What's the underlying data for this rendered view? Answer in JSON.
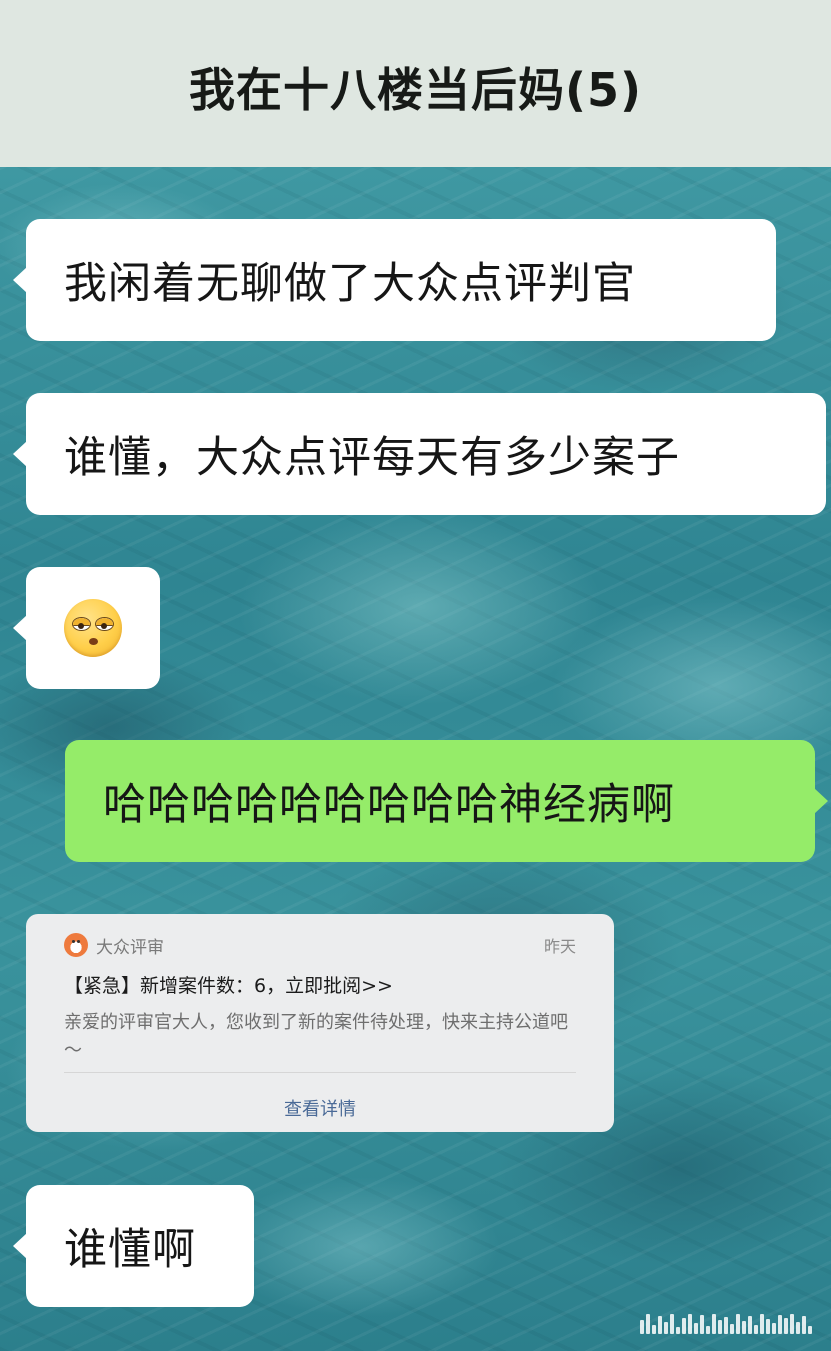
{
  "header": {
    "title": "我在十八楼当后妈(5)"
  },
  "messages": [
    {
      "side": "left",
      "text": "我闲着无聊做了大众点评判官"
    },
    {
      "side": "left",
      "text": "谁懂，大众点评每天有多少案子"
    },
    {
      "side": "left",
      "emoji": "flushed-face-emoji"
    },
    {
      "side": "right",
      "text": "哈哈哈哈哈哈哈哈哈神经病啊"
    },
    {
      "side": "left",
      "type": "notification-card"
    },
    {
      "side": "left",
      "text": "谁懂啊"
    }
  ],
  "card": {
    "app_name": "大众评审",
    "time": "昨天",
    "title": "【紧急】新增案件数：6，立即批阅>>",
    "body": "亲爱的评审官大人，您收到了新的案件待处理，快来主持公道吧～",
    "link_label": "查看详情",
    "logo_icon": "red-panda-logo-icon"
  },
  "colors": {
    "header_bg": "#dfe7e1",
    "bubble_left": "#ffffff",
    "bubble_right": "#95ec69",
    "link": "#4a6a97"
  }
}
